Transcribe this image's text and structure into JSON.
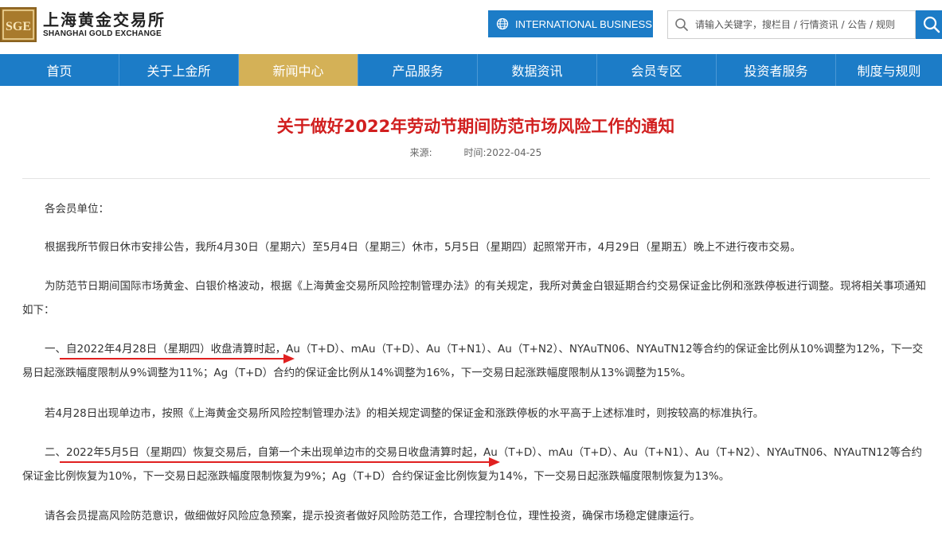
{
  "header": {
    "logo_mark": "SGE",
    "logo_cn": "上海黄金交易所",
    "logo_en": "SHANGHAI GOLD EXCHANGE",
    "intl_button": "INTERNATIONAL BUSINESS",
    "search_placeholder": "请输入关键字，搜栏目 / 行情资讯 / 公告 / 规则"
  },
  "nav": {
    "items": [
      {
        "label": "首页"
      },
      {
        "label": "关于上金所"
      },
      {
        "label": "新闻中心"
      },
      {
        "label": "产品服务"
      },
      {
        "label": "数据资讯"
      },
      {
        "label": "会员专区"
      },
      {
        "label": "投资者服务"
      },
      {
        "label": "制度与规则"
      }
    ],
    "active_index": 2
  },
  "article": {
    "title": "关于做好2022年劳动节期间防范市场风险工作的通知",
    "source_label": "来源:",
    "time_label": "时间:2022-04-25",
    "paragraphs": [
      "各会员单位：",
      "根据我所节假日休市安排公告，我所4月30日（星期六）至5月4日（星期三）休市，5月5日（星期四）起照常开市，4月29日（星期五）晚上不进行夜市交易。",
      "为防范节日期间国际市场黄金、白银价格波动，根据《上海黄金交易所风险控制管理办法》的有关规定，我所对黄金白银延期合约交易保证金比例和涨跌停板进行调整。现将相关事项通知如下：",
      "一、自2022年4月28日（星期四）收盘清算时起，Au（T+D）、mAu（T+D）、Au（T+N1）、Au（T+N2）、NYAuTN06、NYAuTN12等合约的保证金比例从10%调整为12%，下一交易日起涨跌幅度限制从9%调整为11%；Ag（T+D）合约的保证金比例从14%调整为16%，下一交易日起涨跌幅度限制从13%调整为15%。",
      "若4月28日出现单边市，按照《上海黄金交易所风险控制管理办法》的相关规定调整的保证金和涨跌停板的水平高于上述标准时，则按较高的标准执行。",
      "二、2022年5月5日（星期四）恢复交易后，自第一个未出现单边市的交易日收盘清算时起，Au（T+D）、mAu（T+D）、Au（T+N1）、Au（T+N2）、NYAuTN06、NYAuTN12等合约保证金比例恢复为10%，下一交易日起涨跌幅度限制恢复为9%；Ag（T+D）合约保证金比例恢复为14%，下一交易日起涨跌幅度限制恢复为13%。",
      "请各会员提高风险防范意识，做细做好风险应急预案，提示投资者做好风险防范工作，合理控制仓位，理性投资，确保市场稳定健康运行。"
    ]
  },
  "colors": {
    "brand_blue": "#1c7cc7",
    "active_gold": "#d4b157",
    "title_red": "#d11f1f",
    "annotation_red": "#e02020"
  },
  "icons": {
    "globe": "globe-icon",
    "search": "search-icon",
    "search_button": "search-icon"
  }
}
